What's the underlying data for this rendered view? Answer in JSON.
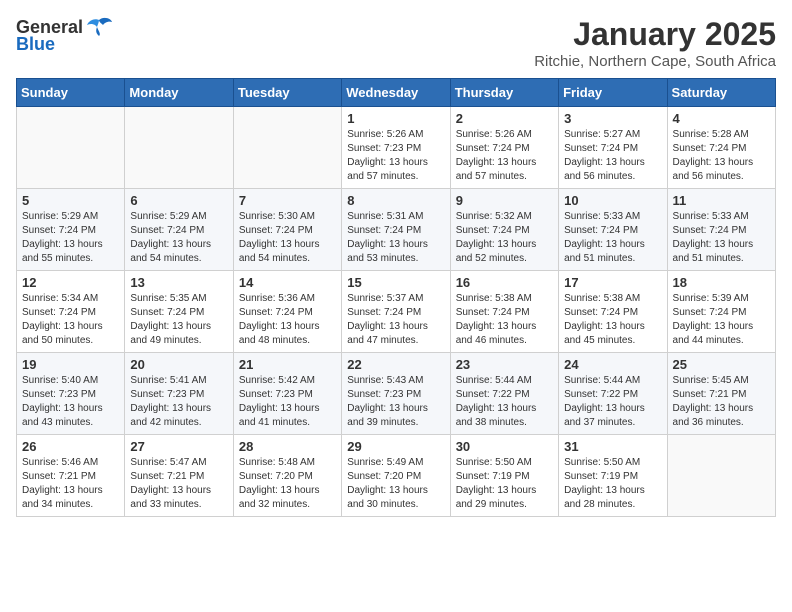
{
  "logo": {
    "text_general": "General",
    "text_blue": "Blue"
  },
  "title": "January 2025",
  "subtitle": "Ritchie, Northern Cape, South Africa",
  "days_of_week": [
    "Sunday",
    "Monday",
    "Tuesday",
    "Wednesday",
    "Thursday",
    "Friday",
    "Saturday"
  ],
  "weeks": [
    [
      {
        "day": "",
        "info": ""
      },
      {
        "day": "",
        "info": ""
      },
      {
        "day": "",
        "info": ""
      },
      {
        "day": "1",
        "info": "Sunrise: 5:26 AM\nSunset: 7:23 PM\nDaylight: 13 hours and 57 minutes."
      },
      {
        "day": "2",
        "info": "Sunrise: 5:26 AM\nSunset: 7:24 PM\nDaylight: 13 hours and 57 minutes."
      },
      {
        "day": "3",
        "info": "Sunrise: 5:27 AM\nSunset: 7:24 PM\nDaylight: 13 hours and 56 minutes."
      },
      {
        "day": "4",
        "info": "Sunrise: 5:28 AM\nSunset: 7:24 PM\nDaylight: 13 hours and 56 minutes."
      }
    ],
    [
      {
        "day": "5",
        "info": "Sunrise: 5:29 AM\nSunset: 7:24 PM\nDaylight: 13 hours and 55 minutes."
      },
      {
        "day": "6",
        "info": "Sunrise: 5:29 AM\nSunset: 7:24 PM\nDaylight: 13 hours and 54 minutes."
      },
      {
        "day": "7",
        "info": "Sunrise: 5:30 AM\nSunset: 7:24 PM\nDaylight: 13 hours and 54 minutes."
      },
      {
        "day": "8",
        "info": "Sunrise: 5:31 AM\nSunset: 7:24 PM\nDaylight: 13 hours and 53 minutes."
      },
      {
        "day": "9",
        "info": "Sunrise: 5:32 AM\nSunset: 7:24 PM\nDaylight: 13 hours and 52 minutes."
      },
      {
        "day": "10",
        "info": "Sunrise: 5:33 AM\nSunset: 7:24 PM\nDaylight: 13 hours and 51 minutes."
      },
      {
        "day": "11",
        "info": "Sunrise: 5:33 AM\nSunset: 7:24 PM\nDaylight: 13 hours and 51 minutes."
      }
    ],
    [
      {
        "day": "12",
        "info": "Sunrise: 5:34 AM\nSunset: 7:24 PM\nDaylight: 13 hours and 50 minutes."
      },
      {
        "day": "13",
        "info": "Sunrise: 5:35 AM\nSunset: 7:24 PM\nDaylight: 13 hours and 49 minutes."
      },
      {
        "day": "14",
        "info": "Sunrise: 5:36 AM\nSunset: 7:24 PM\nDaylight: 13 hours and 48 minutes."
      },
      {
        "day": "15",
        "info": "Sunrise: 5:37 AM\nSunset: 7:24 PM\nDaylight: 13 hours and 47 minutes."
      },
      {
        "day": "16",
        "info": "Sunrise: 5:38 AM\nSunset: 7:24 PM\nDaylight: 13 hours and 46 minutes."
      },
      {
        "day": "17",
        "info": "Sunrise: 5:38 AM\nSunset: 7:24 PM\nDaylight: 13 hours and 45 minutes."
      },
      {
        "day": "18",
        "info": "Sunrise: 5:39 AM\nSunset: 7:24 PM\nDaylight: 13 hours and 44 minutes."
      }
    ],
    [
      {
        "day": "19",
        "info": "Sunrise: 5:40 AM\nSunset: 7:23 PM\nDaylight: 13 hours and 43 minutes."
      },
      {
        "day": "20",
        "info": "Sunrise: 5:41 AM\nSunset: 7:23 PM\nDaylight: 13 hours and 42 minutes."
      },
      {
        "day": "21",
        "info": "Sunrise: 5:42 AM\nSunset: 7:23 PM\nDaylight: 13 hours and 41 minutes."
      },
      {
        "day": "22",
        "info": "Sunrise: 5:43 AM\nSunset: 7:23 PM\nDaylight: 13 hours and 39 minutes."
      },
      {
        "day": "23",
        "info": "Sunrise: 5:44 AM\nSunset: 7:22 PM\nDaylight: 13 hours and 38 minutes."
      },
      {
        "day": "24",
        "info": "Sunrise: 5:44 AM\nSunset: 7:22 PM\nDaylight: 13 hours and 37 minutes."
      },
      {
        "day": "25",
        "info": "Sunrise: 5:45 AM\nSunset: 7:21 PM\nDaylight: 13 hours and 36 minutes."
      }
    ],
    [
      {
        "day": "26",
        "info": "Sunrise: 5:46 AM\nSunset: 7:21 PM\nDaylight: 13 hours and 34 minutes."
      },
      {
        "day": "27",
        "info": "Sunrise: 5:47 AM\nSunset: 7:21 PM\nDaylight: 13 hours and 33 minutes."
      },
      {
        "day": "28",
        "info": "Sunrise: 5:48 AM\nSunset: 7:20 PM\nDaylight: 13 hours and 32 minutes."
      },
      {
        "day": "29",
        "info": "Sunrise: 5:49 AM\nSunset: 7:20 PM\nDaylight: 13 hours and 30 minutes."
      },
      {
        "day": "30",
        "info": "Sunrise: 5:50 AM\nSunset: 7:19 PM\nDaylight: 13 hours and 29 minutes."
      },
      {
        "day": "31",
        "info": "Sunrise: 5:50 AM\nSunset: 7:19 PM\nDaylight: 13 hours and 28 minutes."
      },
      {
        "day": "",
        "info": ""
      }
    ]
  ]
}
